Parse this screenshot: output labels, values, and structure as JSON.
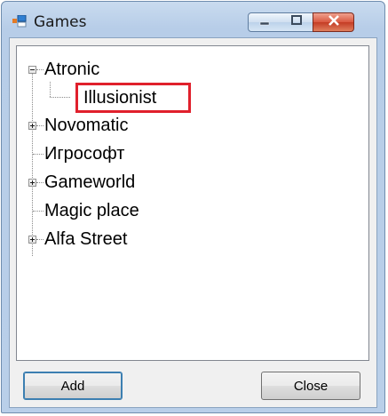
{
  "window": {
    "title": "Games",
    "icon": "form-icon",
    "controls": [
      "minimize",
      "maximize",
      "close"
    ]
  },
  "tree": {
    "nodes": [
      {
        "label": "Atronic",
        "expanded": true,
        "children": [
          {
            "label": "Illusionist",
            "editing": true
          }
        ]
      },
      {
        "label": "Novomatic",
        "expanded": false,
        "has_children": true
      },
      {
        "label": "Игрософт",
        "has_children": false
      },
      {
        "label": "Gameworld",
        "expanded": false,
        "has_children": true
      },
      {
        "label": "Magic place",
        "has_children": false
      },
      {
        "label": "Alfa Street",
        "expanded": false,
        "has_children": true
      }
    ],
    "edit_value": "Illusionist"
  },
  "buttons": {
    "add": "Add",
    "close": "Close"
  },
  "colors": {
    "edit_highlight": "#e0202c",
    "title_bar": "#b9cfe9",
    "close_button": "#c43c24"
  }
}
